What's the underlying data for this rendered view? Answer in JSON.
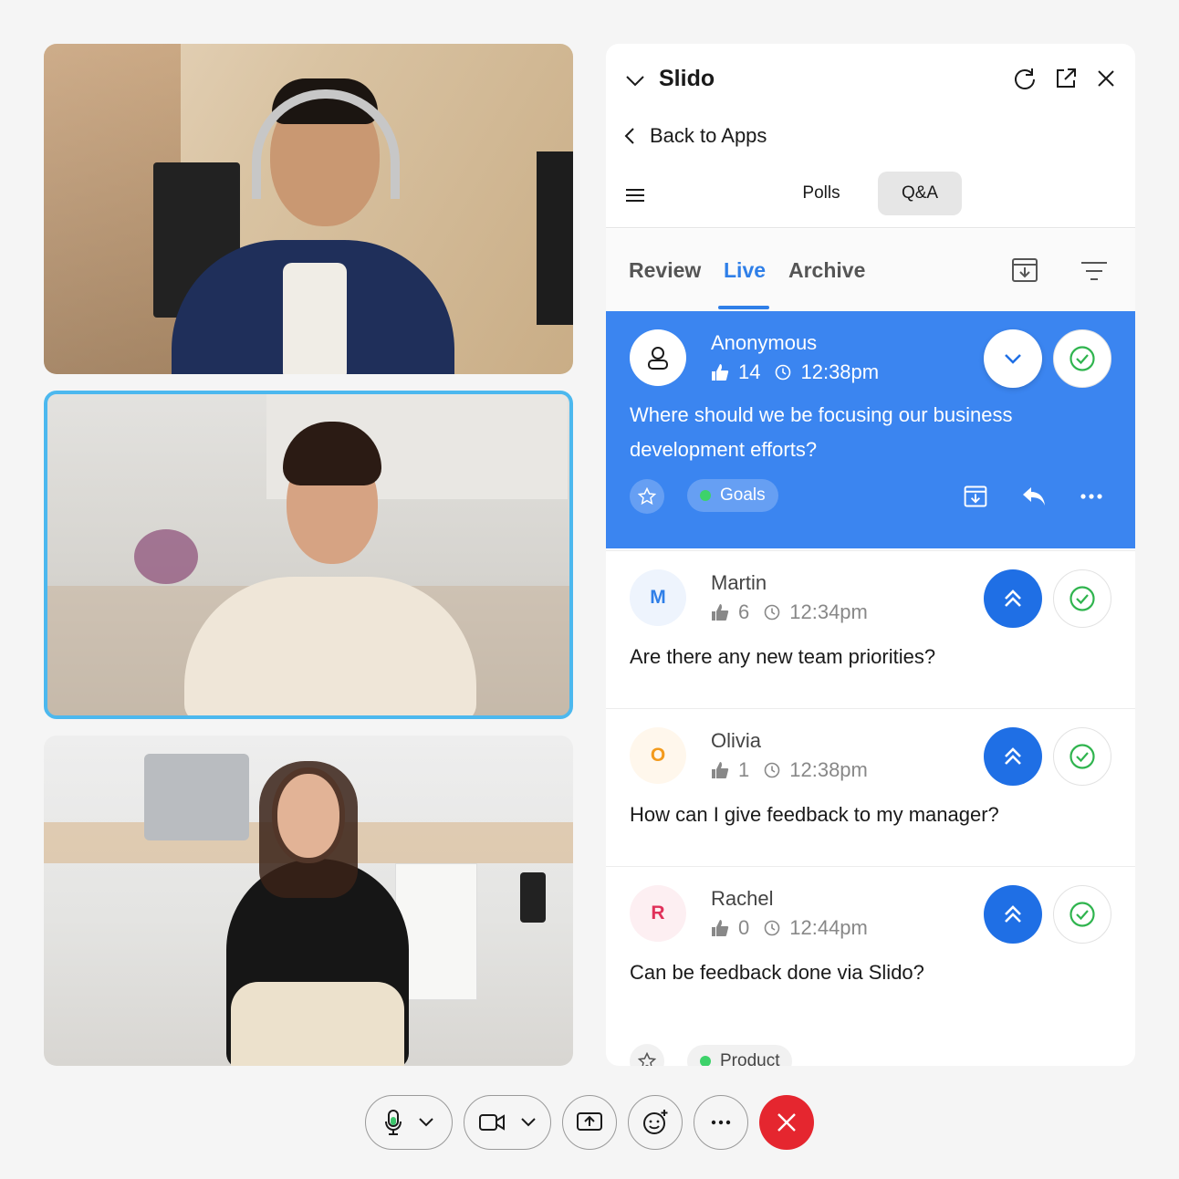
{
  "video_tiles": [
    {
      "participant": "man-with-headphones",
      "active": false
    },
    {
      "participant": "woman-speaking",
      "active": true
    },
    {
      "participant": "woman-seated",
      "active": false
    }
  ],
  "panel": {
    "title": "Slido",
    "back_label": "Back to Apps",
    "segments": {
      "polls": "Polls",
      "qa": "Q&A",
      "selected": "Q&A"
    },
    "tabs": {
      "review": "Review",
      "live": "Live",
      "archive": "Archive",
      "selected": "Live"
    },
    "accent": "#3b85f0"
  },
  "questions": [
    {
      "author": "Anonymous",
      "likes": "14",
      "time": "12:38pm",
      "text": "Where should we be focusing our business development efforts?",
      "tag": "Goals",
      "active": true
    },
    {
      "author": "Martin",
      "initial": "M",
      "initial_color": "#2f7fe8",
      "likes": "6",
      "time": "12:34pm",
      "text": "Are there any new team priorities?"
    },
    {
      "author": "Olivia",
      "initial": "O",
      "initial_color": "#f39a1c",
      "likes": "1",
      "time": "12:38pm",
      "text": "How can I give feedback to my manager?"
    },
    {
      "author": "Rachel",
      "initial": "R",
      "initial_color": "#e0315a",
      "likes": "0",
      "time": "12:44pm",
      "text": "Can be feedback done via Slido?",
      "tag": "Product"
    }
  ],
  "controls": {
    "end_color": "#e5262f"
  }
}
